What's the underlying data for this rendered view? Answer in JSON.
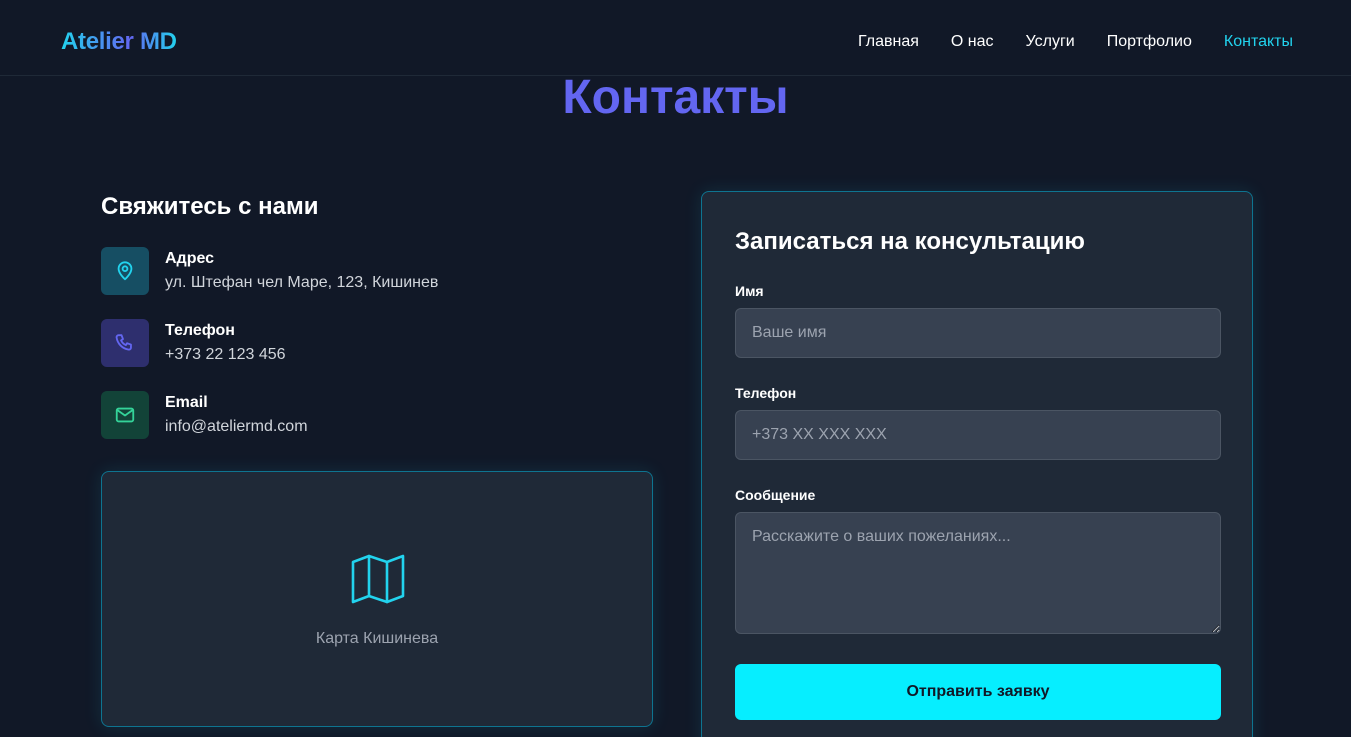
{
  "header": {
    "logo": "Atelier MD",
    "nav": [
      {
        "label": "Главная",
        "active": false
      },
      {
        "label": "О нас",
        "active": false
      },
      {
        "label": "Услуги",
        "active": false
      },
      {
        "label": "Портфолио",
        "active": false
      },
      {
        "label": "Контакты",
        "active": true
      }
    ]
  },
  "page_title": "Контакты",
  "contact": {
    "heading": "Свяжитесь с нами",
    "items": [
      {
        "label": "Адрес",
        "value": "ул. Штефан чел Маре, 123, Кишинев",
        "icon": "map-pin-icon",
        "color": "#22d3ee"
      },
      {
        "label": "Телефон",
        "value": "+373 22 123 456",
        "icon": "phone-icon",
        "color": "#6366f1"
      },
      {
        "label": "Email",
        "value": "info@ateliermd.com",
        "icon": "mail-icon",
        "color": "#34d399"
      }
    ],
    "map_caption": "Карта Кишинева",
    "map_icon": "map-icon"
  },
  "form": {
    "title": "Записаться на консультацию",
    "name_label": "Имя",
    "name_placeholder": "Ваше имя",
    "phone_label": "Телефон",
    "phone_placeholder": "+373 XX XXX XXX",
    "message_label": "Сообщение",
    "message_placeholder": "Расскажите о ваших пожеланиях...",
    "submit_label": "Отправить заявку"
  },
  "colors": {
    "background": "#111827",
    "card": "#1f2937",
    "accent_cyan": "#22d3ee",
    "accent_indigo": "#6366f1",
    "button": "#06eeff"
  }
}
